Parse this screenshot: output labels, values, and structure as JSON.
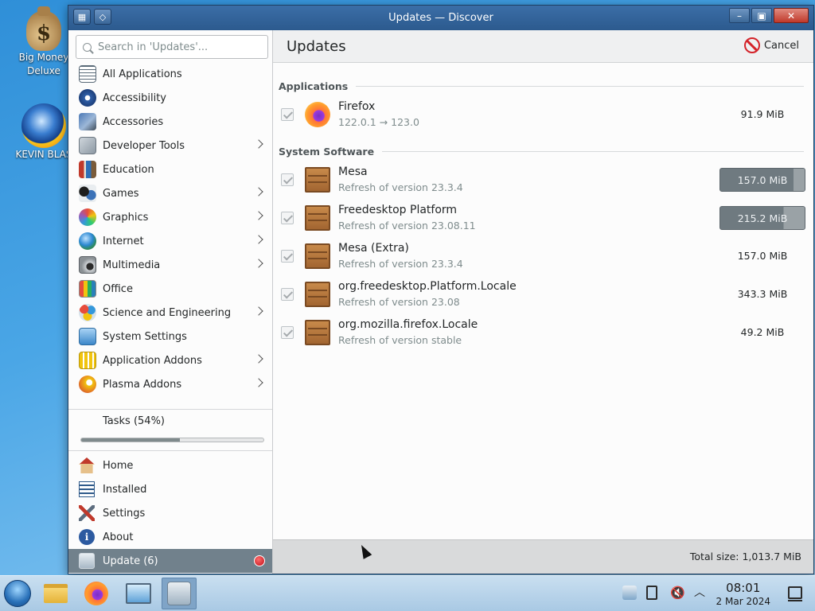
{
  "desktop": {
    "icons": [
      {
        "label": "Big Money\nDeluxe",
        "line1": "Big Money",
        "line2": "Deluxe"
      },
      {
        "label": "KEVIN BLAS",
        "line1": "KEVIN BLAS"
      }
    ]
  },
  "window": {
    "title": "Updates — Discover",
    "colors": {
      "titlebar": "#3b6ea7",
      "active_item": "#71818c",
      "cancel_red": "#d4232a"
    }
  },
  "sidebar": {
    "search_placeholder": "Search in 'Updates'...",
    "categories": [
      {
        "label": "All Applications",
        "icon": "grid-icon",
        "has_children": false
      },
      {
        "label": "Accessibility",
        "icon": "accessibility-icon",
        "has_children": false
      },
      {
        "label": "Accessories",
        "icon": "accessories-icon",
        "has_children": false
      },
      {
        "label": "Developer Tools",
        "icon": "developer-tools-icon",
        "has_children": true
      },
      {
        "label": "Education",
        "icon": "education-icon",
        "has_children": false
      },
      {
        "label": "Games",
        "icon": "games-icon",
        "has_children": true
      },
      {
        "label": "Graphics",
        "icon": "graphics-icon",
        "has_children": true
      },
      {
        "label": "Internet",
        "icon": "internet-icon",
        "has_children": true
      },
      {
        "label": "Multimedia",
        "icon": "multimedia-icon",
        "has_children": true
      },
      {
        "label": "Office",
        "icon": "office-icon",
        "has_children": false
      },
      {
        "label": "Science and Engineering",
        "icon": "science-icon",
        "has_children": true
      },
      {
        "label": "System Settings",
        "icon": "system-settings-icon",
        "has_children": false
      },
      {
        "label": "Application Addons",
        "icon": "addons-icon",
        "has_children": true
      },
      {
        "label": "Plasma Addons",
        "icon": "plasma-addons-icon",
        "has_children": true
      }
    ],
    "tasks": {
      "label": "Tasks (54%)",
      "progress": 0.54
    },
    "nav": [
      {
        "label": "Home",
        "icon": "home-icon"
      },
      {
        "label": "Installed",
        "icon": "installed-icon"
      },
      {
        "label": "Settings",
        "icon": "settings-icon"
      },
      {
        "label": "About",
        "icon": "about-icon"
      },
      {
        "label": "Update (6)",
        "icon": "update-icon",
        "active": true
      }
    ]
  },
  "main": {
    "title": "Updates",
    "cancel_label": "Cancel",
    "sections": [
      {
        "title": "Applications",
        "items": [
          {
            "name": "Firefox",
            "detail": "122.0.1 → 123.0",
            "size": "91.9 MiB",
            "icon": "firefox-icon",
            "downloading": false
          }
        ]
      },
      {
        "title": "System Software",
        "items": [
          {
            "name": "Mesa",
            "detail": "Refresh of version 23.3.4",
            "size": "157.0 MiB",
            "icon": "package-icon",
            "downloading": true,
            "progress": 0.87
          },
          {
            "name": "Freedesktop Platform",
            "detail": "Refresh of version 23.08.11",
            "size": "215.2 MiB",
            "icon": "package-icon",
            "downloading": true,
            "progress": 0.75
          },
          {
            "name": "Mesa (Extra)",
            "detail": "Refresh of version 23.3.4",
            "size": "157.0 MiB",
            "icon": "package-icon",
            "downloading": false
          },
          {
            "name": "org.freedesktop.Platform.Locale",
            "detail": "Refresh of version 23.08",
            "size": "343.3 MiB",
            "icon": "package-icon",
            "downloading": false
          },
          {
            "name": "org.mozilla.firefox.Locale",
            "detail": "Refresh of version stable",
            "size": "49.2 MiB",
            "icon": "package-icon",
            "downloading": false
          }
        ]
      }
    ],
    "total_size": "Total size: 1,013.7 MiB"
  },
  "taskbar": {
    "apps": [
      "start-orb-icon",
      "file-manager-icon",
      "firefox-icon",
      "system-monitor-icon",
      "discover-icon"
    ],
    "tray": [
      "updates-tray-icon",
      "clipboard-icon",
      "volume-muted-icon",
      "chevron-up-icon"
    ],
    "time": "08:01",
    "date": "2 Mar 2024"
  }
}
